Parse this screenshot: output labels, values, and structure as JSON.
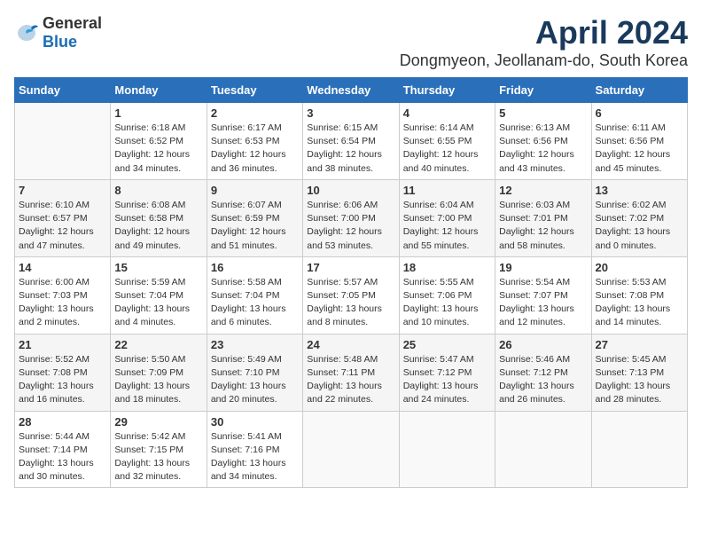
{
  "logo": {
    "text_general": "General",
    "text_blue": "Blue"
  },
  "title": "April 2024",
  "location": "Dongmyeon, Jeollanam-do, South Korea",
  "days_of_week": [
    "Sunday",
    "Monday",
    "Tuesday",
    "Wednesday",
    "Thursday",
    "Friday",
    "Saturday"
  ],
  "weeks": [
    [
      {
        "day": "",
        "info": ""
      },
      {
        "day": "1",
        "info": "Sunrise: 6:18 AM\nSunset: 6:52 PM\nDaylight: 12 hours\nand 34 minutes."
      },
      {
        "day": "2",
        "info": "Sunrise: 6:17 AM\nSunset: 6:53 PM\nDaylight: 12 hours\nand 36 minutes."
      },
      {
        "day": "3",
        "info": "Sunrise: 6:15 AM\nSunset: 6:54 PM\nDaylight: 12 hours\nand 38 minutes."
      },
      {
        "day": "4",
        "info": "Sunrise: 6:14 AM\nSunset: 6:55 PM\nDaylight: 12 hours\nand 40 minutes."
      },
      {
        "day": "5",
        "info": "Sunrise: 6:13 AM\nSunset: 6:56 PM\nDaylight: 12 hours\nand 43 minutes."
      },
      {
        "day": "6",
        "info": "Sunrise: 6:11 AM\nSunset: 6:56 PM\nDaylight: 12 hours\nand 45 minutes."
      }
    ],
    [
      {
        "day": "7",
        "info": "Sunrise: 6:10 AM\nSunset: 6:57 PM\nDaylight: 12 hours\nand 47 minutes."
      },
      {
        "day": "8",
        "info": "Sunrise: 6:08 AM\nSunset: 6:58 PM\nDaylight: 12 hours\nand 49 minutes."
      },
      {
        "day": "9",
        "info": "Sunrise: 6:07 AM\nSunset: 6:59 PM\nDaylight: 12 hours\nand 51 minutes."
      },
      {
        "day": "10",
        "info": "Sunrise: 6:06 AM\nSunset: 7:00 PM\nDaylight: 12 hours\nand 53 minutes."
      },
      {
        "day": "11",
        "info": "Sunrise: 6:04 AM\nSunset: 7:00 PM\nDaylight: 12 hours\nand 55 minutes."
      },
      {
        "day": "12",
        "info": "Sunrise: 6:03 AM\nSunset: 7:01 PM\nDaylight: 12 hours\nand 58 minutes."
      },
      {
        "day": "13",
        "info": "Sunrise: 6:02 AM\nSunset: 7:02 PM\nDaylight: 13 hours\nand 0 minutes."
      }
    ],
    [
      {
        "day": "14",
        "info": "Sunrise: 6:00 AM\nSunset: 7:03 PM\nDaylight: 13 hours\nand 2 minutes."
      },
      {
        "day": "15",
        "info": "Sunrise: 5:59 AM\nSunset: 7:04 PM\nDaylight: 13 hours\nand 4 minutes."
      },
      {
        "day": "16",
        "info": "Sunrise: 5:58 AM\nSunset: 7:04 PM\nDaylight: 13 hours\nand 6 minutes."
      },
      {
        "day": "17",
        "info": "Sunrise: 5:57 AM\nSunset: 7:05 PM\nDaylight: 13 hours\nand 8 minutes."
      },
      {
        "day": "18",
        "info": "Sunrise: 5:55 AM\nSunset: 7:06 PM\nDaylight: 13 hours\nand 10 minutes."
      },
      {
        "day": "19",
        "info": "Sunrise: 5:54 AM\nSunset: 7:07 PM\nDaylight: 13 hours\nand 12 minutes."
      },
      {
        "day": "20",
        "info": "Sunrise: 5:53 AM\nSunset: 7:08 PM\nDaylight: 13 hours\nand 14 minutes."
      }
    ],
    [
      {
        "day": "21",
        "info": "Sunrise: 5:52 AM\nSunset: 7:08 PM\nDaylight: 13 hours\nand 16 minutes."
      },
      {
        "day": "22",
        "info": "Sunrise: 5:50 AM\nSunset: 7:09 PM\nDaylight: 13 hours\nand 18 minutes."
      },
      {
        "day": "23",
        "info": "Sunrise: 5:49 AM\nSunset: 7:10 PM\nDaylight: 13 hours\nand 20 minutes."
      },
      {
        "day": "24",
        "info": "Sunrise: 5:48 AM\nSunset: 7:11 PM\nDaylight: 13 hours\nand 22 minutes."
      },
      {
        "day": "25",
        "info": "Sunrise: 5:47 AM\nSunset: 7:12 PM\nDaylight: 13 hours\nand 24 minutes."
      },
      {
        "day": "26",
        "info": "Sunrise: 5:46 AM\nSunset: 7:12 PM\nDaylight: 13 hours\nand 26 minutes."
      },
      {
        "day": "27",
        "info": "Sunrise: 5:45 AM\nSunset: 7:13 PM\nDaylight: 13 hours\nand 28 minutes."
      }
    ],
    [
      {
        "day": "28",
        "info": "Sunrise: 5:44 AM\nSunset: 7:14 PM\nDaylight: 13 hours\nand 30 minutes."
      },
      {
        "day": "29",
        "info": "Sunrise: 5:42 AM\nSunset: 7:15 PM\nDaylight: 13 hours\nand 32 minutes."
      },
      {
        "day": "30",
        "info": "Sunrise: 5:41 AM\nSunset: 7:16 PM\nDaylight: 13 hours\nand 34 minutes."
      },
      {
        "day": "",
        "info": ""
      },
      {
        "day": "",
        "info": ""
      },
      {
        "day": "",
        "info": ""
      },
      {
        "day": "",
        "info": ""
      }
    ]
  ]
}
